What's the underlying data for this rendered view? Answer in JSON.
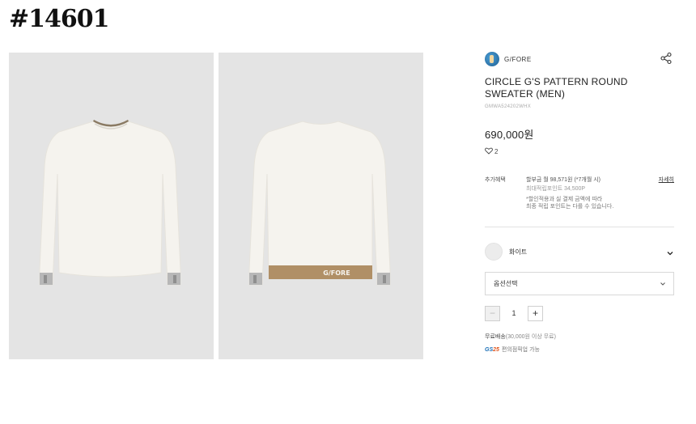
{
  "page_id": "#14601",
  "brand": {
    "name": "G/FORE",
    "logo_icon": "brand-logo-icon"
  },
  "product": {
    "title": "CIRCLE G'S PATTERN ROUND SWEATER (MEN)",
    "sku": "GMWA524202WHX",
    "price": "690,000원",
    "likes": "2",
    "back_logo_text": "G/FORE"
  },
  "benefit": {
    "label": "추가혜택",
    "installment": "할부금 월 98,571원 (*7개월 시)",
    "points": "최대적립포인트 34,500P",
    "note_line1": "*할인적용과 실 결제 금액에 따라",
    "note_line2": "최종 적립 포인트는 다를 수 있습니다.",
    "detail_link": "자세히"
  },
  "color_option": {
    "name": "화이트",
    "swatch_color": "#ececec"
  },
  "option_select": {
    "label": "옵션선택"
  },
  "quantity": {
    "minus": "−",
    "value": "1",
    "plus": "+"
  },
  "shipping": {
    "label": "무료배송",
    "condition": "(30,000원 이상 무료)"
  },
  "pickup": {
    "logo_prefix": "GS",
    "logo_num": "25",
    "text": "편의점픽업 가능"
  },
  "colors": {
    "sweater": "#f5f3ee",
    "trim": "#b08f66",
    "photo_bg": "#e4e4e4"
  }
}
